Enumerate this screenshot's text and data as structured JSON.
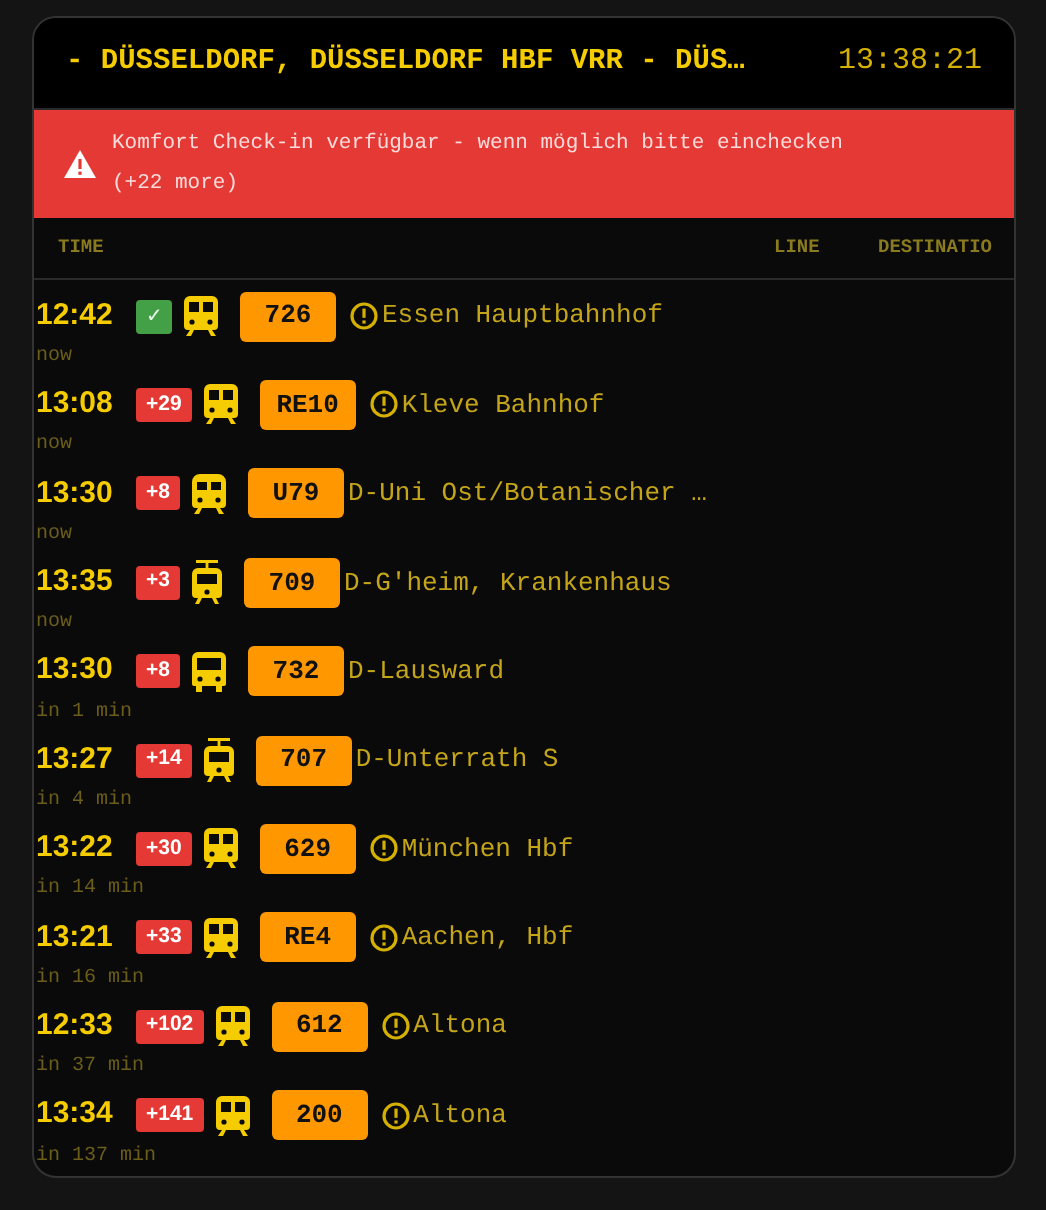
{
  "header": {
    "title": "- DÜSSELDORF, DÜSSELDORF HBF VRR - DÜS…",
    "clock": "13:38:21"
  },
  "alert": {
    "message": "Komfort Check-in verfügbar - wenn möglich bitte einchecken",
    "more": "(+22 more)"
  },
  "columns": [
    "TIME",
    "LINE",
    "DESTINATIO"
  ],
  "departures": [
    {
      "time": "12:42",
      "delay": {
        "kind": "ok",
        "text": "✓"
      },
      "kind": "train",
      "line": "726",
      "warning": true,
      "destination": "Essen Hauptbahnhof",
      "eta": "now"
    },
    {
      "time": "13:08",
      "delay": {
        "kind": "late",
        "text": "+29"
      },
      "kind": "train",
      "line": "RE10",
      "warning": true,
      "destination": "Kleve Bahnhof",
      "eta": "now"
    },
    {
      "time": "13:30",
      "delay": {
        "kind": "late",
        "text": "+8"
      },
      "kind": "metro",
      "line": "U79",
      "warning": false,
      "destination": "D-Uni Ost/Botanischer …",
      "eta": "now"
    },
    {
      "time": "13:35",
      "delay": {
        "kind": "late",
        "text": "+3"
      },
      "kind": "tram",
      "line": "709",
      "warning": false,
      "destination": "D-G'heim, Krankenhaus",
      "eta": "now"
    },
    {
      "time": "13:30",
      "delay": {
        "kind": "late",
        "text": "+8"
      },
      "kind": "bus",
      "line": "732",
      "warning": false,
      "destination": "D-Lausward",
      "eta": "in 1 min"
    },
    {
      "time": "13:27",
      "delay": {
        "kind": "late",
        "text": "+14"
      },
      "kind": "tram",
      "line": "707",
      "warning": false,
      "destination": "D-Unterrath S",
      "eta": "in 4 min"
    },
    {
      "time": "13:22",
      "delay": {
        "kind": "late",
        "text": "+30"
      },
      "kind": "train",
      "line": "629",
      "warning": true,
      "destination": "München Hbf",
      "eta": "in 14 min"
    },
    {
      "time": "13:21",
      "delay": {
        "kind": "late",
        "text": "+33"
      },
      "kind": "train",
      "line": "RE4",
      "warning": true,
      "destination": "Aachen, Hbf",
      "eta": "in 16 min"
    },
    {
      "time": "12:33",
      "delay": {
        "kind": "late",
        "text": "+102"
      },
      "kind": "train",
      "line": "612",
      "warning": true,
      "destination": "Altona",
      "eta": "in 37 min"
    },
    {
      "time": "13:34",
      "delay": {
        "kind": "late",
        "text": "+141"
      },
      "kind": "train",
      "line": "200",
      "warning": true,
      "destination": "Altona",
      "eta": "in 137 min"
    }
  ]
}
